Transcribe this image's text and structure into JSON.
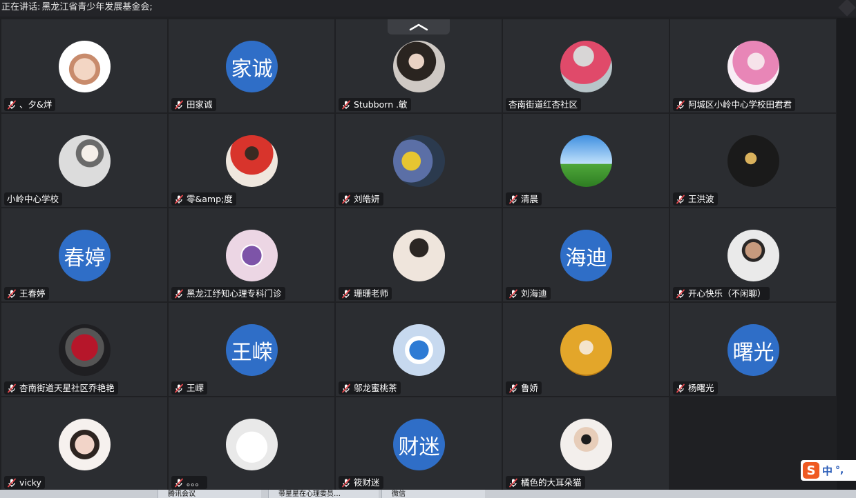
{
  "topbar": {
    "speaking_prefix": "正在讲话:",
    "speaking_name": "黑龙江省青少年发展基金会;"
  },
  "participants": [
    {
      "name": "、夕&烊",
      "avatar_type": "photo",
      "avatar_icon": "cartoon-girl-avatar",
      "muted": true
    },
    {
      "name": "田家诚",
      "avatar_type": "text",
      "avatar_text": "家诚",
      "muted": true
    },
    {
      "name": "Stubborn .敏",
      "avatar_type": "photo",
      "avatar_icon": "woman-portrait-avatar",
      "muted": true
    },
    {
      "name": "杏南街道红杏社区",
      "avatar_type": "photo",
      "avatar_icon": "girl-with-roses-avatar",
      "muted": false
    },
    {
      "name": "阿城区小岭中心学校田君君",
      "avatar_type": "photo",
      "avatar_icon": "pink-hair-anime-avatar",
      "muted": true
    },
    {
      "name": "小岭中心学校",
      "avatar_type": "photo",
      "avatar_icon": "boy-with-dog-avatar",
      "muted": false
    },
    {
      "name": "零&amp;度",
      "avatar_type": "photo",
      "avatar_icon": "boy-red-jacket-avatar",
      "muted": true
    },
    {
      "name": "刘皓妍",
      "avatar_type": "photo",
      "avatar_icon": "plush-toys-avatar",
      "muted": true
    },
    {
      "name": "清晨",
      "avatar_type": "photo",
      "avatar_icon": "sky-grassland-avatar",
      "muted": true
    },
    {
      "name": "王洪波",
      "avatar_type": "photo",
      "avatar_icon": "golden-dragon-avatar",
      "muted": true
    },
    {
      "name": "王春婷",
      "avatar_type": "text",
      "avatar_text": "春婷",
      "muted": true
    },
    {
      "name": "黑龙江纾知心理专科门诊",
      "avatar_type": "photo",
      "avatar_icon": "clinic-logo-avatar",
      "muted": true
    },
    {
      "name": "珊珊老师",
      "avatar_type": "photo",
      "avatar_icon": "two-women-avatar",
      "muted": true
    },
    {
      "name": "刘海迪",
      "avatar_type": "text",
      "avatar_text": "海迪",
      "muted": true
    },
    {
      "name": "开心快乐（不闲聊）",
      "avatar_type": "photo",
      "avatar_icon": "id-photo-avatar",
      "muted": true
    },
    {
      "name": "杏南街道天星社区乔艳艳",
      "avatar_type": "photo",
      "avatar_icon": "rose-bouquet-avatar",
      "muted": true
    },
    {
      "name": "王嵘",
      "avatar_type": "text",
      "avatar_text": "王嵘",
      "muted": true
    },
    {
      "name": "邬龙蜜桃茶",
      "avatar_type": "photo",
      "avatar_icon": "doraemon-avatar",
      "muted": true
    },
    {
      "name": "鲁娇",
      "avatar_type": "photo",
      "avatar_icon": "gold-coins-avatar",
      "muted": true
    },
    {
      "name": "杨曙光",
      "avatar_type": "text",
      "avatar_text": "曙光",
      "muted": true
    },
    {
      "name": "vicky",
      "avatar_type": "photo",
      "avatar_icon": "girl-selfie-avatar",
      "muted": true
    },
    {
      "name": "。。。",
      "avatar_type": "photo",
      "avatar_icon": "white-bunny-avatar",
      "muted": true
    },
    {
      "name": "筱财迷",
      "avatar_type": "text",
      "avatar_text": "财迷",
      "muted": true
    },
    {
      "name": "橘色的大耳朵猫",
      "avatar_type": "photo",
      "avatar_icon": "toddler-sunglasses-avatar",
      "muted": true
    }
  ],
  "ime": {
    "logo": "S",
    "mode": "中",
    "punct": "°,"
  },
  "taskbar": {
    "items": [
      "腾讯会议",
      "带星星在心理委员…",
      "微信"
    ]
  },
  "colors": {
    "tile_bg": "#2b2d31",
    "text_avatar_bg": "#2f6ec7",
    "window_bg": "#1f2023"
  }
}
